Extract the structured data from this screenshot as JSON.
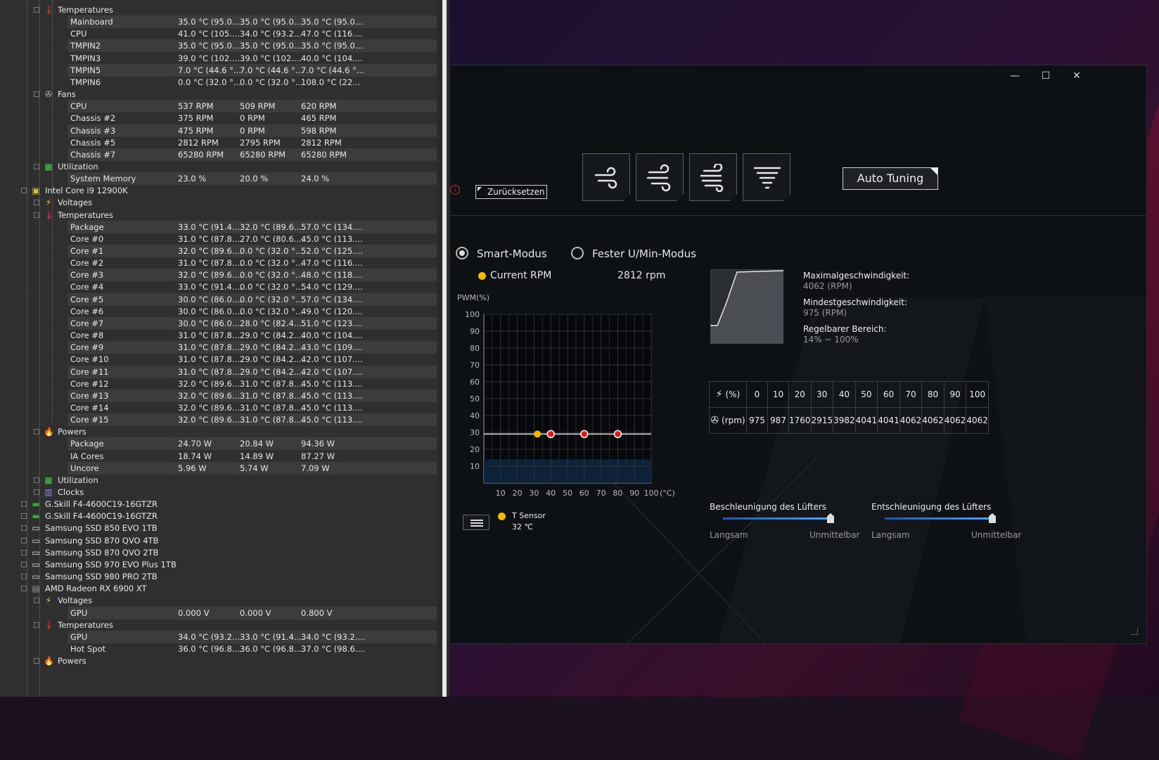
{
  "hwinfo": {
    "rows": [
      {
        "level": 2,
        "icon": "thermometer-icon",
        "label": "Temperatures",
        "c1": "",
        "c2": "",
        "c3": "",
        "band": false
      },
      {
        "level": 3,
        "label": "Mainboard",
        "c1": "35.0 °C (95.0...",
        "c2": "35.0 °C (95.0...",
        "c3": "35.0 °C (95.0...",
        "band": true
      },
      {
        "level": 3,
        "label": "CPU",
        "c1": "41.0 °C (105....",
        "c2": "34.0 °C (93.2...",
        "c3": "47.0 °C (116....",
        "band": false
      },
      {
        "level": 3,
        "label": "TMPIN2",
        "c1": "35.0 °C (95.0...",
        "c2": "35.0 °C (95.0...",
        "c3": "35.0 °C (95.0...",
        "band": true
      },
      {
        "level": 3,
        "label": "TMPIN3",
        "c1": "39.0 °C (102....",
        "c2": "39.0 °C (102....",
        "c3": "40.0 °C (104....",
        "band": false
      },
      {
        "level": 3,
        "label": "TMPIN5",
        "c1": "7.0 °C (44.6 °...",
        "c2": "7.0 °C (44.6 °...",
        "c3": "7.0 °C (44.6 °...",
        "band": true
      },
      {
        "level": 3,
        "label": "TMPIN6",
        "c1": "0.0 °C (32.0 °...",
        "c2": "0.0 °C (32.0 °...",
        "c3": "108.0 °C (22...",
        "band": false
      },
      {
        "level": 2,
        "icon": "fan-icon",
        "label": "Fans",
        "c1": "",
        "c2": "",
        "c3": "",
        "band": false
      },
      {
        "level": 3,
        "label": "CPU",
        "c1": "537 RPM",
        "c2": "509 RPM",
        "c3": "620 RPM",
        "band": true
      },
      {
        "level": 3,
        "label": "Chassis #2",
        "c1": "375 RPM",
        "c2": "0 RPM",
        "c3": "465 RPM",
        "band": false
      },
      {
        "level": 3,
        "label": "Chassis #3",
        "c1": "475 RPM",
        "c2": "0 RPM",
        "c3": "598 RPM",
        "band": true
      },
      {
        "level": 3,
        "label": "Chassis #5",
        "c1": "2812 RPM",
        "c2": "2795 RPM",
        "c3": "2812 RPM",
        "band": false
      },
      {
        "level": 3,
        "label": "Chassis #7",
        "c1": "65280 RPM",
        "c2": "65280 RPM",
        "c3": "65280 RPM",
        "band": true
      },
      {
        "level": 2,
        "icon": "utilization-icon",
        "label": "Utilization",
        "c1": "",
        "c2": "",
        "c3": "",
        "band": false
      },
      {
        "level": 3,
        "label": "System Memory",
        "c1": "23.0 %",
        "c2": "20.0 %",
        "c3": "24.0 %",
        "band": true
      },
      {
        "level": 1,
        "icon": "chip-icon",
        "label": "Intel Core i9 12900K",
        "c1": "",
        "c2": "",
        "c3": "",
        "band": false
      },
      {
        "level": 2,
        "icon": "voltage-icon",
        "label": "Voltages",
        "c1": "",
        "c2": "",
        "c3": "",
        "band": false
      },
      {
        "level": 2,
        "icon": "thermometer-icon",
        "label": "Temperatures",
        "c1": "",
        "c2": "",
        "c3": "",
        "band": false
      },
      {
        "level": 3,
        "label": "Package",
        "c1": "33.0 °C (91.4....",
        "c2": "32.0 °C (89.6....",
        "c3": "57.0 °C (134....",
        "band": true
      },
      {
        "level": 3,
        "label": "Core #0",
        "c1": "31.0 °C (87.8....",
        "c2": "27.0 °C (80.6....",
        "c3": "45.0 °C (113....",
        "band": false
      },
      {
        "level": 3,
        "label": "Core #1",
        "c1": "32.0 °C (89.6....",
        "c2": "0.0 °C (32.0 °...",
        "c3": "52.0 °C (125....",
        "band": true
      },
      {
        "level": 3,
        "label": "Core #2",
        "c1": "31.0 °C (87.8....",
        "c2": "0.0 °C (32.0 °...",
        "c3": "47.0 °C (116....",
        "band": false
      },
      {
        "level": 3,
        "label": "Core #3",
        "c1": "32.0 °C (89.6....",
        "c2": "0.0 °C (32.0 °...",
        "c3": "48.0 °C (118....",
        "band": true
      },
      {
        "level": 3,
        "label": "Core #4",
        "c1": "33.0 °C (91.4....",
        "c2": "0.0 °C (32.0 °...",
        "c3": "54.0 °C (129....",
        "band": false
      },
      {
        "level": 3,
        "label": "Core #5",
        "c1": "30.0 °C (86.0....",
        "c2": "0.0 °C (32.0 °...",
        "c3": "57.0 °C (134....",
        "band": true
      },
      {
        "level": 3,
        "label": "Core #6",
        "c1": "30.0 °C (86.0....",
        "c2": "0.0 °C (32.0 °...",
        "c3": "49.0 °C (120....",
        "band": false
      },
      {
        "level": 3,
        "label": "Core #7",
        "c1": "30.0 °C (86.0....",
        "c2": "28.0 °C (82.4....",
        "c3": "51.0 °C (123....",
        "band": true
      },
      {
        "level": 3,
        "label": "Core #8",
        "c1": "31.0 °C (87.8....",
        "c2": "29.0 °C (84.2....",
        "c3": "40.0 °C (104....",
        "band": false
      },
      {
        "level": 3,
        "label": "Core #9",
        "c1": "31.0 °C (87.8....",
        "c2": "29.0 °C (84.2....",
        "c3": "43.0 °C (109....",
        "band": true
      },
      {
        "level": 3,
        "label": "Core #10",
        "c1": "31.0 °C (87.8....",
        "c2": "29.0 °C (84.2....",
        "c3": "42.0 °C (107....",
        "band": false
      },
      {
        "level": 3,
        "label": "Core #11",
        "c1": "31.0 °C (87.8....",
        "c2": "29.0 °C (84.2....",
        "c3": "42.0 °C (107....",
        "band": true
      },
      {
        "level": 3,
        "label": "Core #12",
        "c1": "32.0 °C (89.6....",
        "c2": "31.0 °C (87.8....",
        "c3": "45.0 °C (113....",
        "band": false
      },
      {
        "level": 3,
        "label": "Core #13",
        "c1": "32.0 °C (89.6....",
        "c2": "31.0 °C (87.8....",
        "c3": "45.0 °C (113....",
        "band": true
      },
      {
        "level": 3,
        "label": "Core #14",
        "c1": "32.0 °C (89.6....",
        "c2": "31.0 °C (87.8....",
        "c3": "45.0 °C (113....",
        "band": false
      },
      {
        "level": 3,
        "label": "Core #15",
        "c1": "32.0 °C (89.6....",
        "c2": "31.0 °C (87.8....",
        "c3": "45.0 °C (113....",
        "band": true
      },
      {
        "level": 2,
        "icon": "power-icon",
        "label": "Powers",
        "c1": "",
        "c2": "",
        "c3": "",
        "band": false
      },
      {
        "level": 3,
        "label": "Package",
        "c1": "24.70 W",
        "c2": "20.84 W",
        "c3": "94.36 W",
        "band": true
      },
      {
        "level": 3,
        "label": "IA Cores",
        "c1": "18.74 W",
        "c2": "14.89 W",
        "c3": "87.27 W",
        "band": false
      },
      {
        "level": 3,
        "label": "Uncore",
        "c1": "5.96 W",
        "c2": "5.74 W",
        "c3": "7.09 W",
        "band": true
      },
      {
        "level": 2,
        "icon": "utilization-icon",
        "label": "Utilization",
        "c1": "",
        "c2": "",
        "c3": "",
        "band": false
      },
      {
        "level": 2,
        "icon": "clock-icon",
        "label": "Clocks",
        "c1": "",
        "c2": "",
        "c3": "",
        "band": false
      },
      {
        "level": 1,
        "icon": "ram-icon",
        "label": "G.Skill F4-4600C19-16GTZR",
        "c1": "",
        "c2": "",
        "c3": "",
        "band": false
      },
      {
        "level": 1,
        "icon": "ram-icon",
        "label": "G.Skill F4-4600C19-16GTZR",
        "c1": "",
        "c2": "",
        "c3": "",
        "band": false
      },
      {
        "level": 1,
        "icon": "drive-icon",
        "label": "Samsung SSD 850 EVO 1TB",
        "c1": "",
        "c2": "",
        "c3": "",
        "band": false
      },
      {
        "level": 1,
        "icon": "drive-icon",
        "label": "Samsung SSD 870 QVO 4TB",
        "c1": "",
        "c2": "",
        "c3": "",
        "band": false
      },
      {
        "level": 1,
        "icon": "drive-icon",
        "label": "Samsung SSD 870 QVO 2TB",
        "c1": "",
        "c2": "",
        "c3": "",
        "band": false
      },
      {
        "level": 1,
        "icon": "drive-icon",
        "label": "Samsung SSD 970 EVO Plus 1TB",
        "c1": "",
        "c2": "",
        "c3": "",
        "band": false
      },
      {
        "level": 1,
        "icon": "drive-icon",
        "label": "Samsung SSD 980 PRO 2TB",
        "c1": "",
        "c2": "",
        "c3": "",
        "band": false
      },
      {
        "level": 1,
        "icon": "gpu-icon",
        "label": "AMD Radeon RX 6900 XT",
        "c1": "",
        "c2": "",
        "c3": "",
        "band": false
      },
      {
        "level": 2,
        "icon": "voltage-icon",
        "label": "Voltages",
        "c1": "",
        "c2": "",
        "c3": "",
        "band": false
      },
      {
        "level": 3,
        "label": "GPU",
        "c1": "0.000 V",
        "c2": "0.000 V",
        "c3": "0.800 V",
        "band": true
      },
      {
        "level": 2,
        "icon": "thermometer-icon",
        "label": "Temperatures",
        "c1": "",
        "c2": "",
        "c3": "",
        "band": false
      },
      {
        "level": 3,
        "label": "GPU",
        "c1": "34.0 °C (93.2....",
        "c2": "33.0 °C (91.4....",
        "c3": "34.0 °C (93.2....",
        "band": true
      },
      {
        "level": 3,
        "label": "Hot Spot",
        "c1": "36.0 °C (96.8....",
        "c2": "36.0 °C (96.8....",
        "c3": "37.0 °C (98.6....",
        "band": false
      },
      {
        "level": 2,
        "icon": "power-icon",
        "label": "Powers",
        "c1": "",
        "c2": "",
        "c3": "",
        "band": false
      }
    ]
  },
  "fanapp": {
    "window_controls": {
      "minimize": "—",
      "maximize": "☐",
      "close": "✕"
    },
    "reset_label": "Zurücksetzen",
    "auto_tuning_label": "Auto Tuning",
    "modes": {
      "smart": "Smart-Modus",
      "fixed": "Fester U/Min-Modus",
      "smart_selected": true
    },
    "current_rpm_label": "Current RPM",
    "current_rpm_value": "2812 rpm",
    "stats": {
      "max_label": "Maximalgeschwindigkeit:",
      "max_value": "4062 (RPM)",
      "min_label": "Mindestgeschwindigkeit:",
      "min_value": "975 (RPM)",
      "range_label": "Regelbarer Bereich:",
      "range_value": "14% ~ 100%"
    },
    "table": {
      "pct_unit": "(%)",
      "rpm_unit": "(rpm)",
      "pct": [
        "0",
        "10",
        "20",
        "30",
        "40",
        "50",
        "60",
        "70",
        "80",
        "90",
        "100"
      ],
      "rpm": [
        "975",
        "987",
        "1760",
        "2915",
        "3982",
        "4041",
        "4041",
        "4062",
        "4062",
        "4062",
        "4062"
      ]
    },
    "sliders": {
      "accel_title": "Beschleunigung des Lüfters",
      "decel_title": "Entschleunigung des Lüfters",
      "slow": "Langsam",
      "fast": "Unmittelbar",
      "accel_level": 1.0,
      "decel_level": 1.0
    },
    "sensor": {
      "name": "T Sensor",
      "value": "32 ℃"
    },
    "colors": {
      "accent": "#f5b800",
      "point": "#e01818",
      "track": "#4aa3ff"
    }
  },
  "chart_data": {
    "type": "line",
    "ylabel": "PWM(%)",
    "xlabel": "(°C)",
    "x_ticks": [
      10,
      20,
      30,
      40,
      50,
      60,
      70,
      80,
      90,
      100
    ],
    "y_ticks": [
      10,
      20,
      30,
      40,
      50,
      60,
      70,
      80,
      90,
      100
    ],
    "xlim": [
      0,
      100
    ],
    "ylim": [
      0,
      100
    ],
    "series": [
      {
        "x": [
          0,
          100
        ],
        "y": [
          29,
          29
        ]
      }
    ],
    "points": [
      {
        "x": 40,
        "y": 29
      },
      {
        "x": 60,
        "y": 29
      },
      {
        "x": 80,
        "y": 29
      }
    ],
    "current_point": {
      "x": 32,
      "y": 29
    },
    "grid": true
  }
}
